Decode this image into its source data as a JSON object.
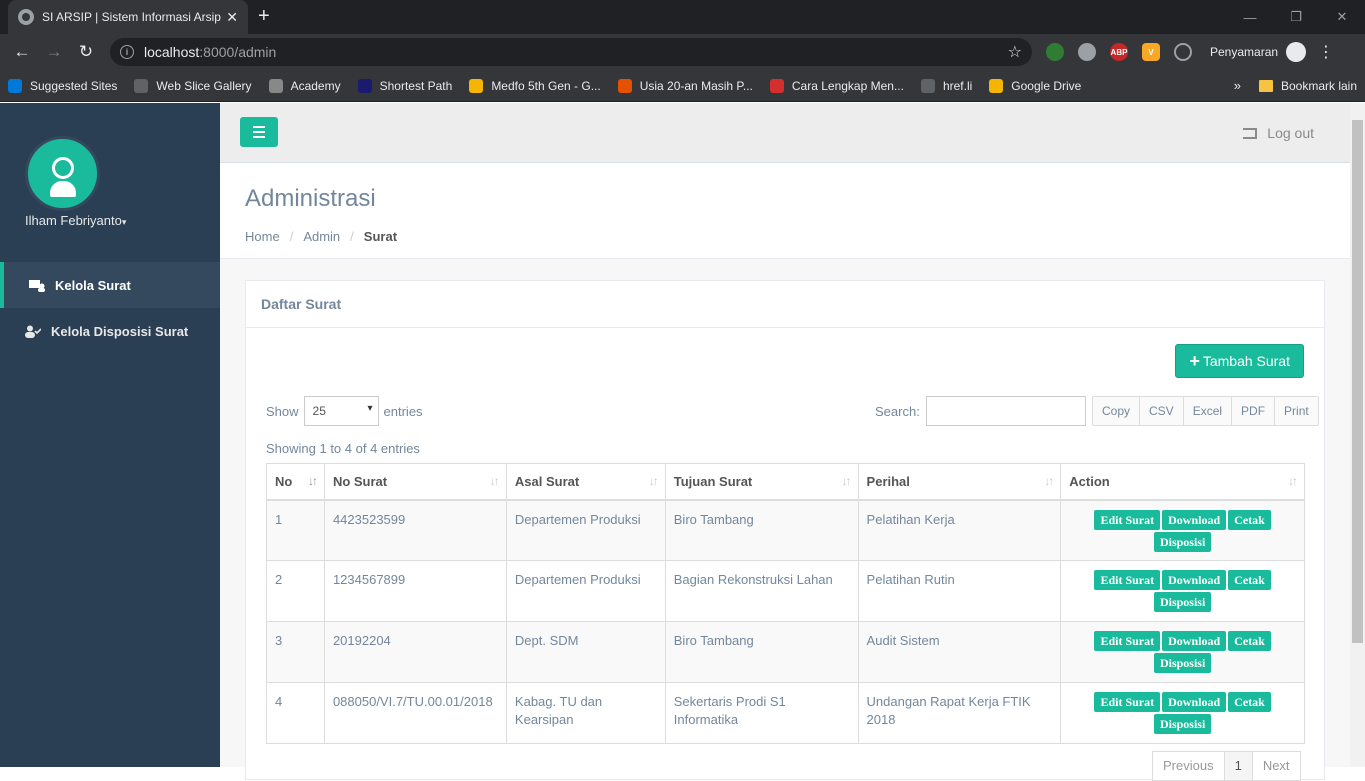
{
  "browser": {
    "tab_title": "SI ARSIP | Sistem Informasi Arsip",
    "tab_close": "✕",
    "new_tab": "+",
    "url_host": "localhost",
    "url_rest": ":8000/admin",
    "profile_label": "Penyamaran",
    "bookmarks": [
      {
        "label": "Suggested Sites",
        "icon": "bing-icon",
        "color": "#0078d7"
      },
      {
        "label": "Web Slice Gallery",
        "icon": "globe-icon",
        "color": "#5f6368"
      },
      {
        "label": "Academy",
        "icon": "academy-icon",
        "color": "#888888"
      },
      {
        "label": "Shortest Path",
        "icon": "s-logo-icon",
        "color": "#1a1a6e"
      },
      {
        "label": "Medfo 5th Gen - G...",
        "icon": "drive-icon",
        "color": "#f4b400"
      },
      {
        "label": "Usia 20-an Masih P...",
        "icon": "hip-icon",
        "color": "#e65100"
      },
      {
        "label": "Cara Lengkap Men...",
        "icon": "red-logo-icon",
        "color": "#d32f2f"
      },
      {
        "label": "href.li",
        "icon": "globe-icon",
        "color": "#5f6368"
      },
      {
        "label": "Google Drive",
        "icon": "drive-icon",
        "color": "#f4b400"
      }
    ],
    "bookmarks_more": "»",
    "other_bookmarks": "Bookmark lain"
  },
  "sidebar": {
    "user_name": "Ilham Febriyanto",
    "items": [
      {
        "label": "Kelola Surat",
        "icon": "mail-users-icon",
        "active": true
      },
      {
        "label": "Kelola Disposisi Surat",
        "icon": "user-check-icon",
        "active": false
      }
    ]
  },
  "topnav": {
    "logout_label": "Log out"
  },
  "page": {
    "title": "Administrasi",
    "breadcrumb": [
      "Home",
      "Admin",
      "Surat"
    ]
  },
  "panel": {
    "title": "Daftar Surat",
    "add_button": "Tambah Surat",
    "show_label": "Show",
    "entries_value": "25",
    "entries_label": "entries",
    "search_label": "Search:",
    "export_buttons": [
      "Copy",
      "CSV",
      "Excel",
      "PDF",
      "Print"
    ],
    "info": "Showing 1 to 4 of 4 entries",
    "columns": [
      "No",
      "No Surat",
      "Asal Surat",
      "Tujuan Surat",
      "Perihal",
      "Action"
    ],
    "rows": [
      {
        "no": "1",
        "no_surat": "4423523599",
        "asal": "Departemen Produksi",
        "tujuan": "Biro Tambang",
        "perihal": "Pelatihan Kerja"
      },
      {
        "no": "2",
        "no_surat": "1234567899",
        "asal": "Departemen Produksi",
        "tujuan": "Bagian Rekonstruksi Lahan",
        "perihal": "Pelatihan Rutin"
      },
      {
        "no": "3",
        "no_surat": "20192204",
        "asal": "Dept. SDM",
        "tujuan": "Biro Tambang",
        "perihal": "Audit Sistem"
      },
      {
        "no": "4",
        "no_surat": "088050/VI.7/TU.00.01/2018",
        "asal": "Kabag. TU dan Kearsipan",
        "tujuan": "Sekertaris Prodi S1 Informatika",
        "perihal": "Undangan Rapat Kerja FTIK 2018"
      }
    ],
    "actions": [
      "Edit Surat",
      "Download",
      "Cetak",
      "Disposisi"
    ],
    "pagination": [
      "Previous",
      "1",
      "Next"
    ]
  },
  "colors": {
    "accent": "#1abb9c",
    "sidebar": "#2a3f54"
  }
}
